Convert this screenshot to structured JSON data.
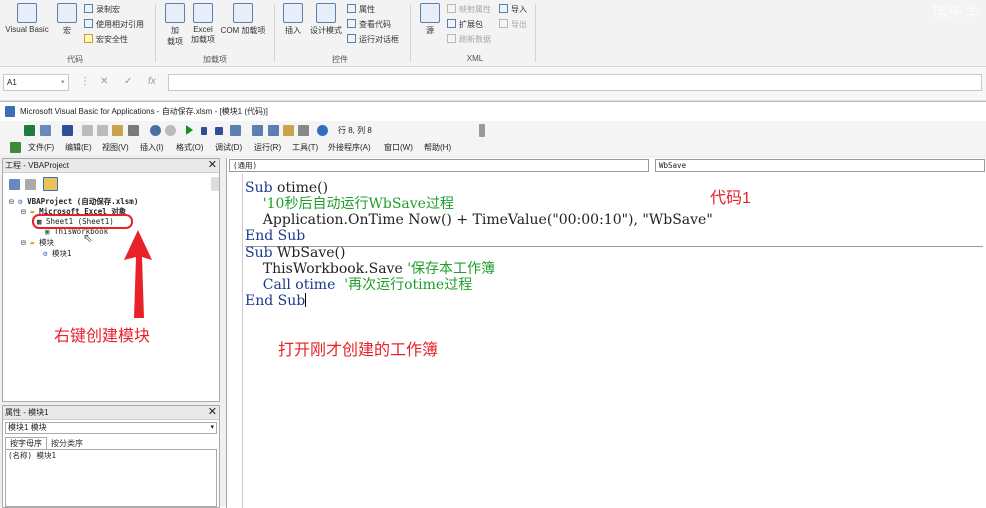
{
  "ribbon": {
    "visual_basic": "Visual Basic",
    "macro": "宏",
    "record_macro": "录制宏",
    "relative_ref": "使用相对引用",
    "macro_security": "宏安全性",
    "group_code": "代码",
    "addins": "加\n载项",
    "excel_addins": "Excel\n加载项",
    "com_addins": "COM 加载项",
    "group_addins": "加载项",
    "insert": "插入",
    "design_mode": "设计模式",
    "properties": "属性",
    "view_code": "查看代码",
    "run_dialog": "运行对话框",
    "group_controls": "控件",
    "source": "源",
    "map_properties": "映射属性",
    "expansion_packs": "扩展包",
    "refresh_data": "刷新数据",
    "import": "导入",
    "export": "导出",
    "group_xml": "XML",
    "watermark": "锛央华"
  },
  "formula_bar": {
    "name_box": "A1",
    "cancel": "✕",
    "enter": "✓",
    "fx": "fx",
    "value": ""
  },
  "vbe": {
    "title": "Microsoft Visual Basic for Applications - 自动保存.xlsm - [模块1 (代码)]",
    "position": "行 8, 列 8",
    "menu": [
      "文件(F)",
      "编辑(E)",
      "视图(V)",
      "插入(I)",
      "格式(O)",
      "调试(D)",
      "运行(R)",
      "工具(T)",
      "外接程序(A)",
      "窗口(W)",
      "帮助(H)"
    ]
  },
  "project": {
    "title": "工程 - VBAProject",
    "root": "VBAProject (自动保存.xlsm)",
    "excel_objects": "Microsoft Excel 对象",
    "sheet1": "Sheet1 (Sheet1)",
    "thisworkbook": "ThisWorkbook",
    "modules": "模块",
    "module1": "模块1"
  },
  "properties_panel": {
    "title": "属性 - 模块1",
    "selector": "模块1 模块",
    "tab_alpha": "按字母序",
    "tab_category": "按分类序",
    "row_label": "(名称)",
    "row_value": "模块1"
  },
  "code_window": {
    "object_combo": "(通用)",
    "proc_combo": "WbSave"
  },
  "code": {
    "l1_kw": "Sub ",
    "l1_rest": "otime()",
    "l2_comment": "    '10秒后自动运行WbSave过程",
    "l3": "    Application.OnTime Now() + TimeValue(\"00:00:10\"), \"WbSave\"",
    "l4_kw": "End Sub",
    "l5_kw": "Sub ",
    "l5_rest": "WbSave()",
    "l6_code": "    ThisWorkbook.Save ",
    "l6_comment": "'保存本工作簿",
    "l7_kw": "    Call ",
    "l7_code": "otime  ",
    "l7_comment": "'再次运行otime过程",
    "l8_kw": "End Sub"
  },
  "annotations": {
    "code_label": "代码1",
    "right_click": "右键创建模块",
    "open_workbook": "打开刚才创建的工作簿"
  },
  "colors": {
    "annotation_red": "#e8212a",
    "vba_keyword": "#1a3a8f",
    "vba_comment": "#1f9e2a"
  }
}
